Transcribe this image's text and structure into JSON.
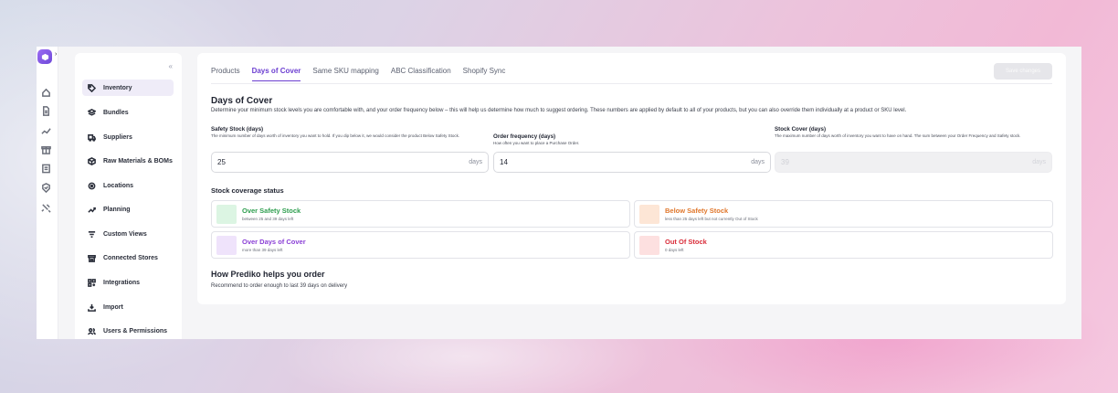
{
  "sidebar": {
    "collapse_label": "«",
    "items": [
      {
        "label": "Inventory",
        "icon": "tag-icon",
        "active": true
      },
      {
        "label": "Bundles",
        "icon": "layers-icon"
      },
      {
        "label": "Suppliers",
        "icon": "truck-icon"
      },
      {
        "label": "Raw Materials & BOMs",
        "icon": "box-icon"
      },
      {
        "label": "Locations",
        "icon": "location-icon"
      },
      {
        "label": "Planning",
        "icon": "trend-icon"
      },
      {
        "label": "Custom Views",
        "icon": "filter-icon"
      },
      {
        "label": "Connected Stores",
        "icon": "store-icon"
      },
      {
        "label": "Integrations",
        "icon": "grid-plus-icon"
      },
      {
        "label": "Import",
        "icon": "download-icon"
      },
      {
        "label": "Users & Permissions",
        "icon": "users-icon"
      }
    ]
  },
  "rail": {
    "expand_label": "›",
    "icons": [
      "home-icon",
      "document-icon",
      "chart-line-icon",
      "gift-icon",
      "list-icon",
      "badge-icon",
      "tools-icon"
    ]
  },
  "tabs": [
    {
      "label": "Products",
      "active": false
    },
    {
      "label": "Days of Cover",
      "active": true
    },
    {
      "label": "Same SKU mapping",
      "active": false
    },
    {
      "label": "ABC Classification",
      "active": false
    },
    {
      "label": "Shopify Sync",
      "active": false
    }
  ],
  "save_label": "Save changes",
  "section": {
    "title": "Days of Cover",
    "description": "Determine your minimum stock levels you are comfortable with, and your order frequency below – this will help us determine how much to suggest ordering. These numbers are applied by default to all of your products, but you can also override them individually at a product or SKU level."
  },
  "fields": {
    "safety": {
      "label": "Safety Stock (days)",
      "help": "The minimum number of days worth of inventory you want to hold. If you dip below it, we would consider the product Below Safety Stock.",
      "value": "25",
      "unit": "days"
    },
    "frequency": {
      "label": "Order frequency (days)",
      "help": "How often you want to place a Purchase Order.",
      "value": "14",
      "unit": "days"
    },
    "cover": {
      "label": "Stock Cover (days)",
      "help": "The maximum number of days worth of inventory you want to have on hand. The sum between your Order Frequency and Safety stock.",
      "value": "39",
      "unit": "days"
    }
  },
  "status": {
    "title": "Stock coverage status",
    "cards": [
      {
        "name": "Over Safety Stock",
        "sub": "between 25 and 39 days left",
        "color": "#2e9e4f",
        "swatch": "#dcf5e3"
      },
      {
        "name": "Below Safety Stock",
        "sub": "less than 25 days left but not currently Out of Stock",
        "color": "#e0772c",
        "swatch": "#fde6d6"
      },
      {
        "name": "Over Days of Cover",
        "sub": "more than 39 days left",
        "color": "#8a3fd6",
        "swatch": "#efe3fb"
      },
      {
        "name": "Out Of Stock",
        "sub": "0 days left",
        "color": "#d92d3a",
        "swatch": "#fde0e0"
      }
    ]
  },
  "how": {
    "title": "How Prediko helps you order",
    "description": "Recommend to order enough to last 39 days on delivery"
  },
  "colors": {
    "accent": "#6c3fd1",
    "brand": "#7b52e0"
  }
}
